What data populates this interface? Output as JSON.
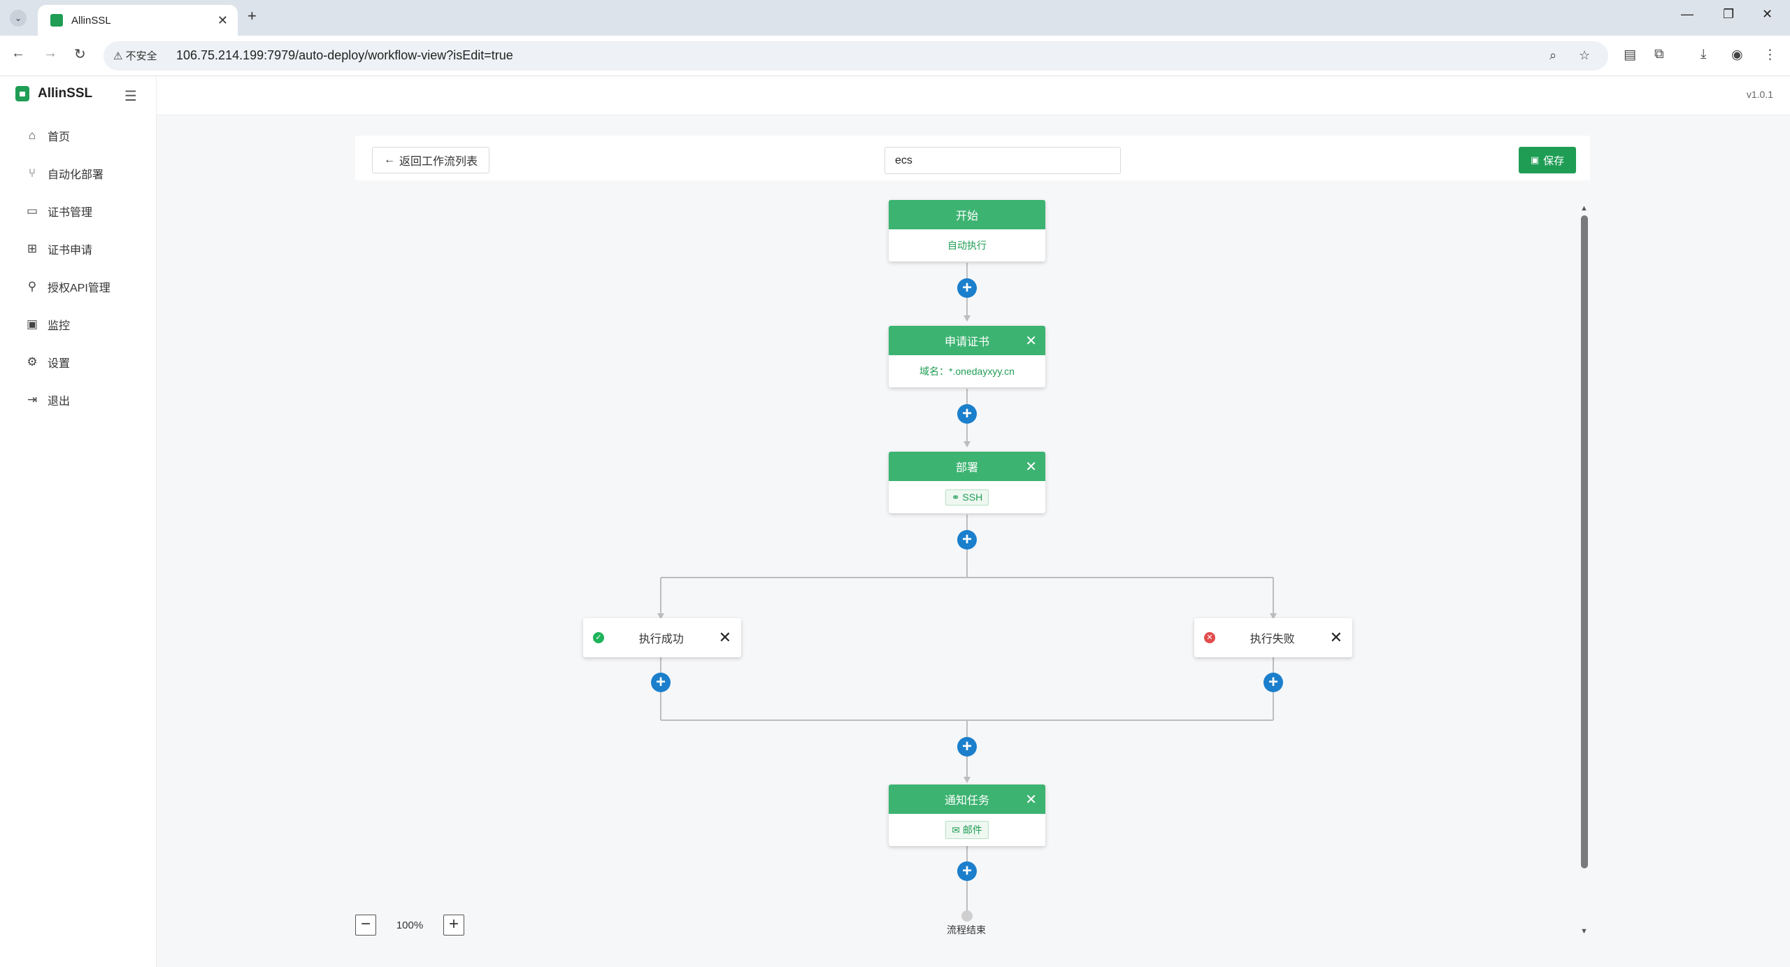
{
  "browser": {
    "tab_title": "AllinSSL",
    "security_label": "不安全",
    "url": "106.75.214.199:7979/auto-deploy/workflow-view?isEdit=true"
  },
  "app": {
    "brand": "AllinSSL",
    "version": "v1.0.1",
    "nav": [
      {
        "label": "首页",
        "icon": "home-icon"
      },
      {
        "label": "自动化部署",
        "icon": "workflow-icon"
      },
      {
        "label": "证书管理",
        "icon": "certificate-icon"
      },
      {
        "label": "证书申请",
        "icon": "add-square-icon"
      },
      {
        "label": "授权API管理",
        "icon": "plug-icon"
      },
      {
        "label": "监控",
        "icon": "monitor-icon"
      },
      {
        "label": "设置",
        "icon": "gear-icon"
      },
      {
        "label": "退出",
        "icon": "logout-icon"
      }
    ]
  },
  "workflow": {
    "back_label": "返回工作流列表",
    "name_value": "ecs",
    "save_label": "保存",
    "nodes": {
      "start": {
        "title": "开始",
        "detail": "自动执行"
      },
      "apply": {
        "title": "申请证书",
        "detail": "域名：*.onedayxyy.cn"
      },
      "deploy": {
        "title": "部署",
        "tag": "SSH"
      },
      "success": {
        "label": "执行成功"
      },
      "fail": {
        "label": "执行失败"
      },
      "notify": {
        "title": "通知任务",
        "tag": "邮件"
      }
    },
    "end_label": "流程结束",
    "zoom_level": "100%"
  }
}
